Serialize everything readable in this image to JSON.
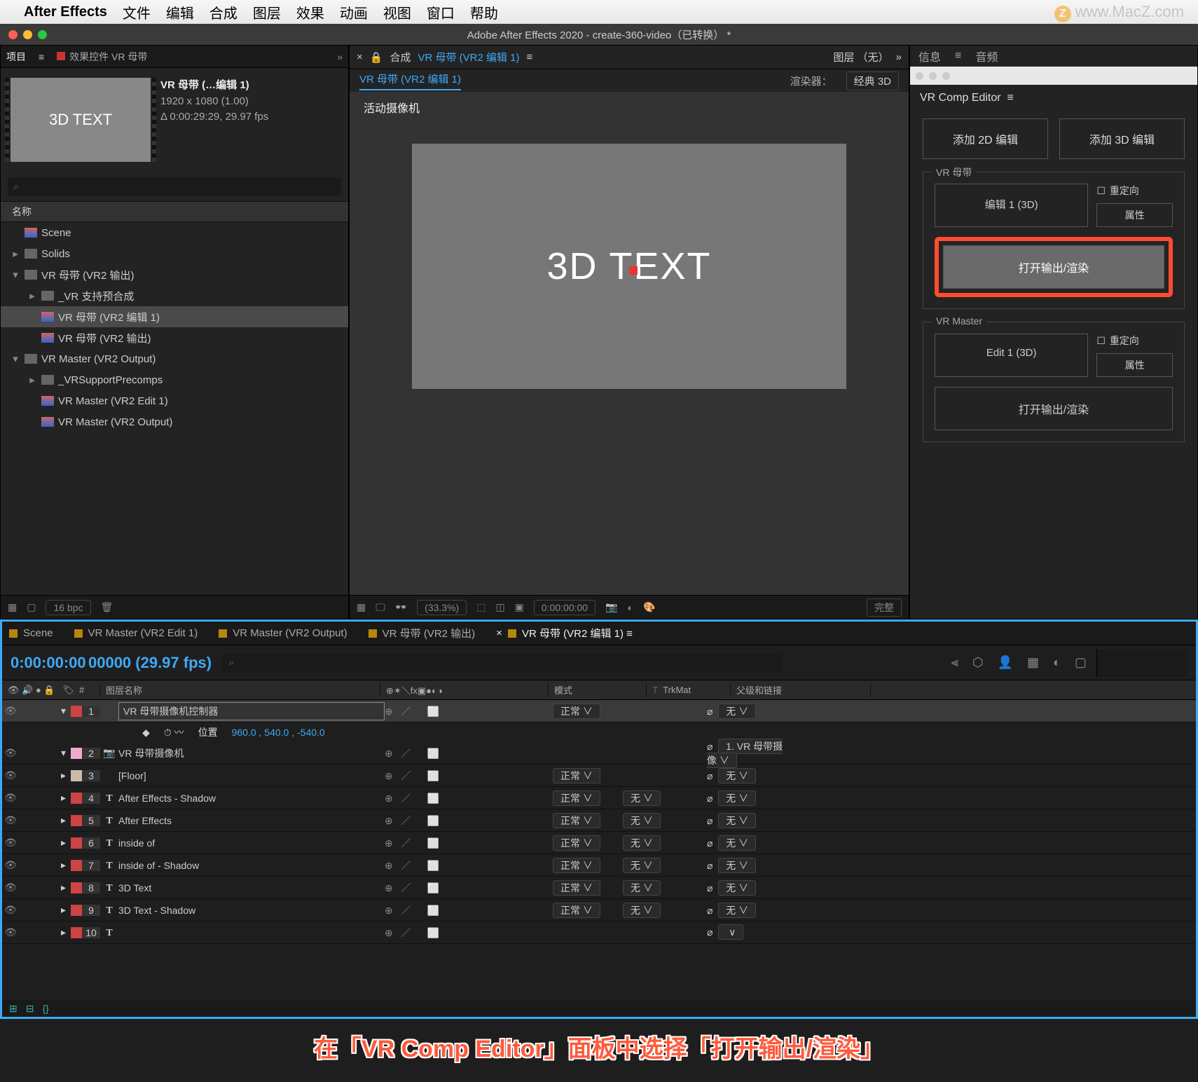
{
  "menubar": {
    "app": "After Effects",
    "items": [
      "文件",
      "编辑",
      "合成",
      "图层",
      "效果",
      "动画",
      "视图",
      "窗口",
      "帮助"
    ]
  },
  "watermark": "www.MacZ.com",
  "window_title": "Adobe After Effects 2020 - create-360-video（已转换） *",
  "project_panel": {
    "tab_project": "项目",
    "tab_fx": "效果控件 VR 母带",
    "thumb_text": "3D TEXT",
    "comp_name": "VR 母带 (…编辑 1)",
    "comp_res": "1920 x 1080 (1.00)",
    "comp_dur": "Δ 0:00:29:29, 29.97 fps",
    "search_ph": "⌕",
    "col_name": "名称",
    "tree": [
      {
        "indent": 0,
        "tw": "",
        "icon": "comp",
        "label": "Scene"
      },
      {
        "indent": 0,
        "tw": "▸",
        "icon": "folder",
        "label": "Solids"
      },
      {
        "indent": 0,
        "tw": "▾",
        "icon": "folder",
        "label": "VR 母带 (VR2 输出)"
      },
      {
        "indent": 1,
        "tw": "▸",
        "icon": "folder",
        "label": "_VR 支持预合成"
      },
      {
        "indent": 1,
        "tw": "",
        "icon": "comp",
        "label": "VR 母带 (VR2 编辑 1)",
        "sel": true
      },
      {
        "indent": 1,
        "tw": "",
        "icon": "comp",
        "label": "VR 母带 (VR2 输出)"
      },
      {
        "indent": 0,
        "tw": "▾",
        "icon": "folder",
        "label": "VR Master (VR2 Output)"
      },
      {
        "indent": 1,
        "tw": "▸",
        "icon": "folder",
        "label": "_VRSupportPrecomps"
      },
      {
        "indent": 1,
        "tw": "",
        "icon": "comp",
        "label": "VR Master (VR2 Edit 1)"
      },
      {
        "indent": 1,
        "tw": "",
        "icon": "comp",
        "label": "VR Master (VR2 Output)"
      }
    ],
    "bpc": "16 bpc"
  },
  "comp_panel": {
    "prefix": "合成",
    "name": "VR 母带 (VR2 编辑 1)",
    "layer_tab": "图层 （无）",
    "breadcrumb": "VR 母带 (VR2 编辑 1)",
    "renderer_label": "渲染器：",
    "renderer_value": "经典 3D",
    "camera_label": "活动摄像机",
    "canvas_text": "3D TEXT",
    "zoom": "(33.3%)",
    "time": "0:00:00:00",
    "quality": "完整"
  },
  "info_tabs": {
    "info": "信息",
    "audio": "音频"
  },
  "vr_panel": {
    "title": "VR Comp Editor",
    "add2d": "添加 2D 编辑",
    "add3d": "添加 3D 编辑",
    "group1": {
      "title": "VR 母带",
      "edit": "编辑 1 (3D)",
      "reorient": "重定向",
      "props": "属性",
      "open": "打开输出/渲染"
    },
    "group2": {
      "title": "VR Master",
      "edit": "Edit 1 (3D)",
      "reorient": "重定向",
      "props": "属性",
      "open": "打开输出/渲染"
    }
  },
  "timeline": {
    "tabs": [
      "Scene",
      "VR Master (VR2 Edit 1)",
      "VR Master (VR2 Output)",
      "VR 母带 (VR2 输出)",
      "VR 母带 (VR2 编辑 1)"
    ],
    "active_tab": 4,
    "timecode": "0:00:00:00",
    "timecode_sub": "00000 (29.97 fps)",
    "search_ph": "⌕",
    "cols": {
      "name": "图层名称",
      "mode": "模式",
      "trk": "TrkMat",
      "parent": "父级和链接"
    },
    "layers": [
      {
        "n": "1",
        "sw": "#c44",
        "type": "box",
        "name": "VR 母带摄像机控制器",
        "mode": "正常",
        "trk": "",
        "parent": "无",
        "sel": true
      },
      {
        "n": "2",
        "sw": "#eac",
        "type": "cam",
        "name": "VR 母带摄像机",
        "mode": "",
        "trk": "",
        "parent": "1. VR 母带摄像"
      },
      {
        "n": "3",
        "sw": "#cba",
        "type": "box",
        "name": "[Floor]",
        "mode": "正常",
        "trk": "",
        "parent": "无"
      },
      {
        "n": "4",
        "sw": "#c44",
        "type": "T",
        "name": "After Effects - Shadow",
        "mode": "正常",
        "trk": "无",
        "parent": "无"
      },
      {
        "n": "5",
        "sw": "#c44",
        "type": "T",
        "name": "After Effects",
        "mode": "正常",
        "trk": "无",
        "parent": "无"
      },
      {
        "n": "6",
        "sw": "#c44",
        "type": "T",
        "name": "inside of",
        "mode": "正常",
        "trk": "无",
        "parent": "无"
      },
      {
        "n": "7",
        "sw": "#c44",
        "type": "T",
        "name": "inside of - Shadow",
        "mode": "正常",
        "trk": "无",
        "parent": "无"
      },
      {
        "n": "8",
        "sw": "#c44",
        "type": "T",
        "name": "3D Text",
        "mode": "正常",
        "trk": "无",
        "parent": "无"
      },
      {
        "n": "9",
        "sw": "#c44",
        "type": "T",
        "name": "3D Text - Shadow",
        "mode": "正常",
        "trk": "无",
        "parent": "无"
      },
      {
        "n": "10",
        "sw": "#c44",
        "type": "T",
        "name": "",
        "mode": "",
        "trk": "",
        "parent": ""
      }
    ],
    "prop_name": "位置",
    "prop_value": "960.0 , 540.0 , -540.0"
  },
  "annotation": "在「VR Comp Editor」面板中选择「打开输出/渲染」"
}
